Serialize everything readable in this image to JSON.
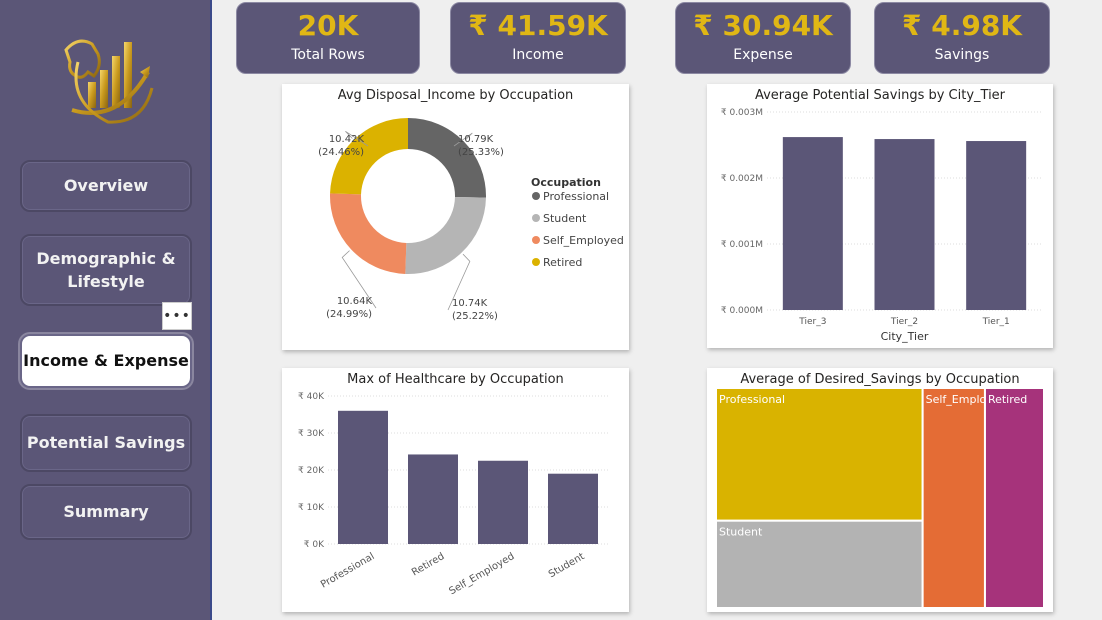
{
  "nav": {
    "overview": "Overview",
    "demographic_line1": "Demographic &",
    "demographic_line2": "Lifestyle",
    "income_expense": "Income & Expense",
    "potential_savings": "Potential Savings",
    "summary": "Summary",
    "more": "•••"
  },
  "kpis": {
    "rows": {
      "value": "20K",
      "label": "Total Rows"
    },
    "income": {
      "value": "₹ 41.59K",
      "label": "Income"
    },
    "expense": {
      "value": "₹ 30.94K",
      "label": "Expense"
    },
    "savings": {
      "value": "₹ 4.98K",
      "label": "Savings"
    }
  },
  "colors": {
    "accent": "#e0b715",
    "sidebar": "#5b5677",
    "bar": "#5b5677",
    "professional": "#656565",
    "student": "#b5b5b5",
    "self_employed": "#ef8a5f",
    "retired": "#dbb200"
  },
  "chart_data": [
    {
      "type": "pie",
      "title": "Avg Disposal_Income by Occupation",
      "legend_title": "Occupation",
      "legend_position": "right",
      "categories": [
        "Professional",
        "Student",
        "Self_Employed",
        "Retired"
      ],
      "values": [
        10.79,
        10.74,
        10.64,
        10.42
      ],
      "value_labels": [
        "10.79K",
        "10.74K",
        "10.64K",
        "10.42K"
      ],
      "percent_labels": [
        "(25.33%)",
        "(25.22%)",
        "(24.99%)",
        "(24.46%)"
      ],
      "colors": [
        "#656565",
        "#b5b5b5",
        "#ef8a5f",
        "#dbb200"
      ]
    },
    {
      "type": "bar",
      "title": "Average Potential Savings by City_Tier",
      "xlabel": "City_Tier",
      "ylabel": "",
      "categories": [
        "Tier_3",
        "Tier_2",
        "Tier_1"
      ],
      "values": [
        0.00262,
        0.00259,
        0.00256
      ],
      "ylim": [
        0,
        0.003
      ],
      "yticks": [
        0,
        0.001,
        0.002,
        0.003
      ],
      "ytick_labels": [
        "₹ 0.000M",
        "₹ 0.001M",
        "₹ 0.002M",
        "₹ 0.003M"
      ],
      "grid": true
    },
    {
      "type": "bar",
      "title": "Max of Healthcare by Occupation",
      "xlabel": "",
      "ylabel": "",
      "categories": [
        "Professional",
        "Retired",
        "Self_Employed",
        "Student"
      ],
      "values": [
        36000,
        24200,
        22500,
        19000
      ],
      "ylim": [
        0,
        40000
      ],
      "yticks": [
        0,
        10000,
        20000,
        30000,
        40000
      ],
      "ytick_labels": [
        "₹ 0K",
        "₹ 10K",
        "₹ 20K",
        "₹ 30K",
        "₹ 40K"
      ],
      "grid": true
    },
    {
      "type": "heatmap",
      "subtype": "treemap",
      "title": "Average of Desired_Savings by Occupation",
      "categories": [
        "Professional",
        "Student",
        "Self_Employed",
        "Retired"
      ],
      "values": [
        38,
        25,
        19,
        18
      ],
      "colors": [
        "#d9b300",
        "#b3b3b3",
        "#e46c35",
        "#a6337b"
      ]
    }
  ]
}
